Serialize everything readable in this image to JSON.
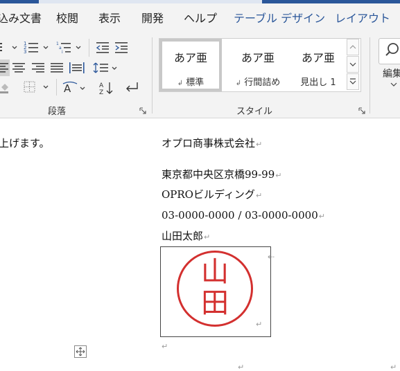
{
  "tabs": [
    {
      "label": "込み文書"
    },
    {
      "label": "校閲"
    },
    {
      "label": "表示"
    },
    {
      "label": "開発"
    },
    {
      "label": "ヘルプ"
    },
    {
      "label": "テーブル デザイン"
    },
    {
      "label": "レイアウト"
    }
  ],
  "ribbon": {
    "paragraph_label": "段落",
    "styles_label": "スタイル",
    "editing_label": "編集",
    "styles": [
      {
        "sample": "あア亜",
        "name": "標準",
        "mark": "↲"
      },
      {
        "sample": "あア亜",
        "name": "行間詰め",
        "mark": "↲"
      },
      {
        "sample": "あア亜",
        "name": "見出し 1"
      }
    ]
  },
  "document": {
    "left_fragment": "上げます。",
    "company": "オプロ商事株式会社",
    "address": "東京都中央区京橋99-99",
    "building": "OPROビルディング",
    "phone": "03-0000-0000 / 03-0000-0000",
    "person": "山田太郎",
    "stamp_text": [
      "山",
      "田"
    ],
    "para_mark": "↵",
    "stamp_color": "#d3302f"
  },
  "colors": {
    "contextual_tab": "#2b579a",
    "ribbon_bg": "#f3f3f3"
  }
}
